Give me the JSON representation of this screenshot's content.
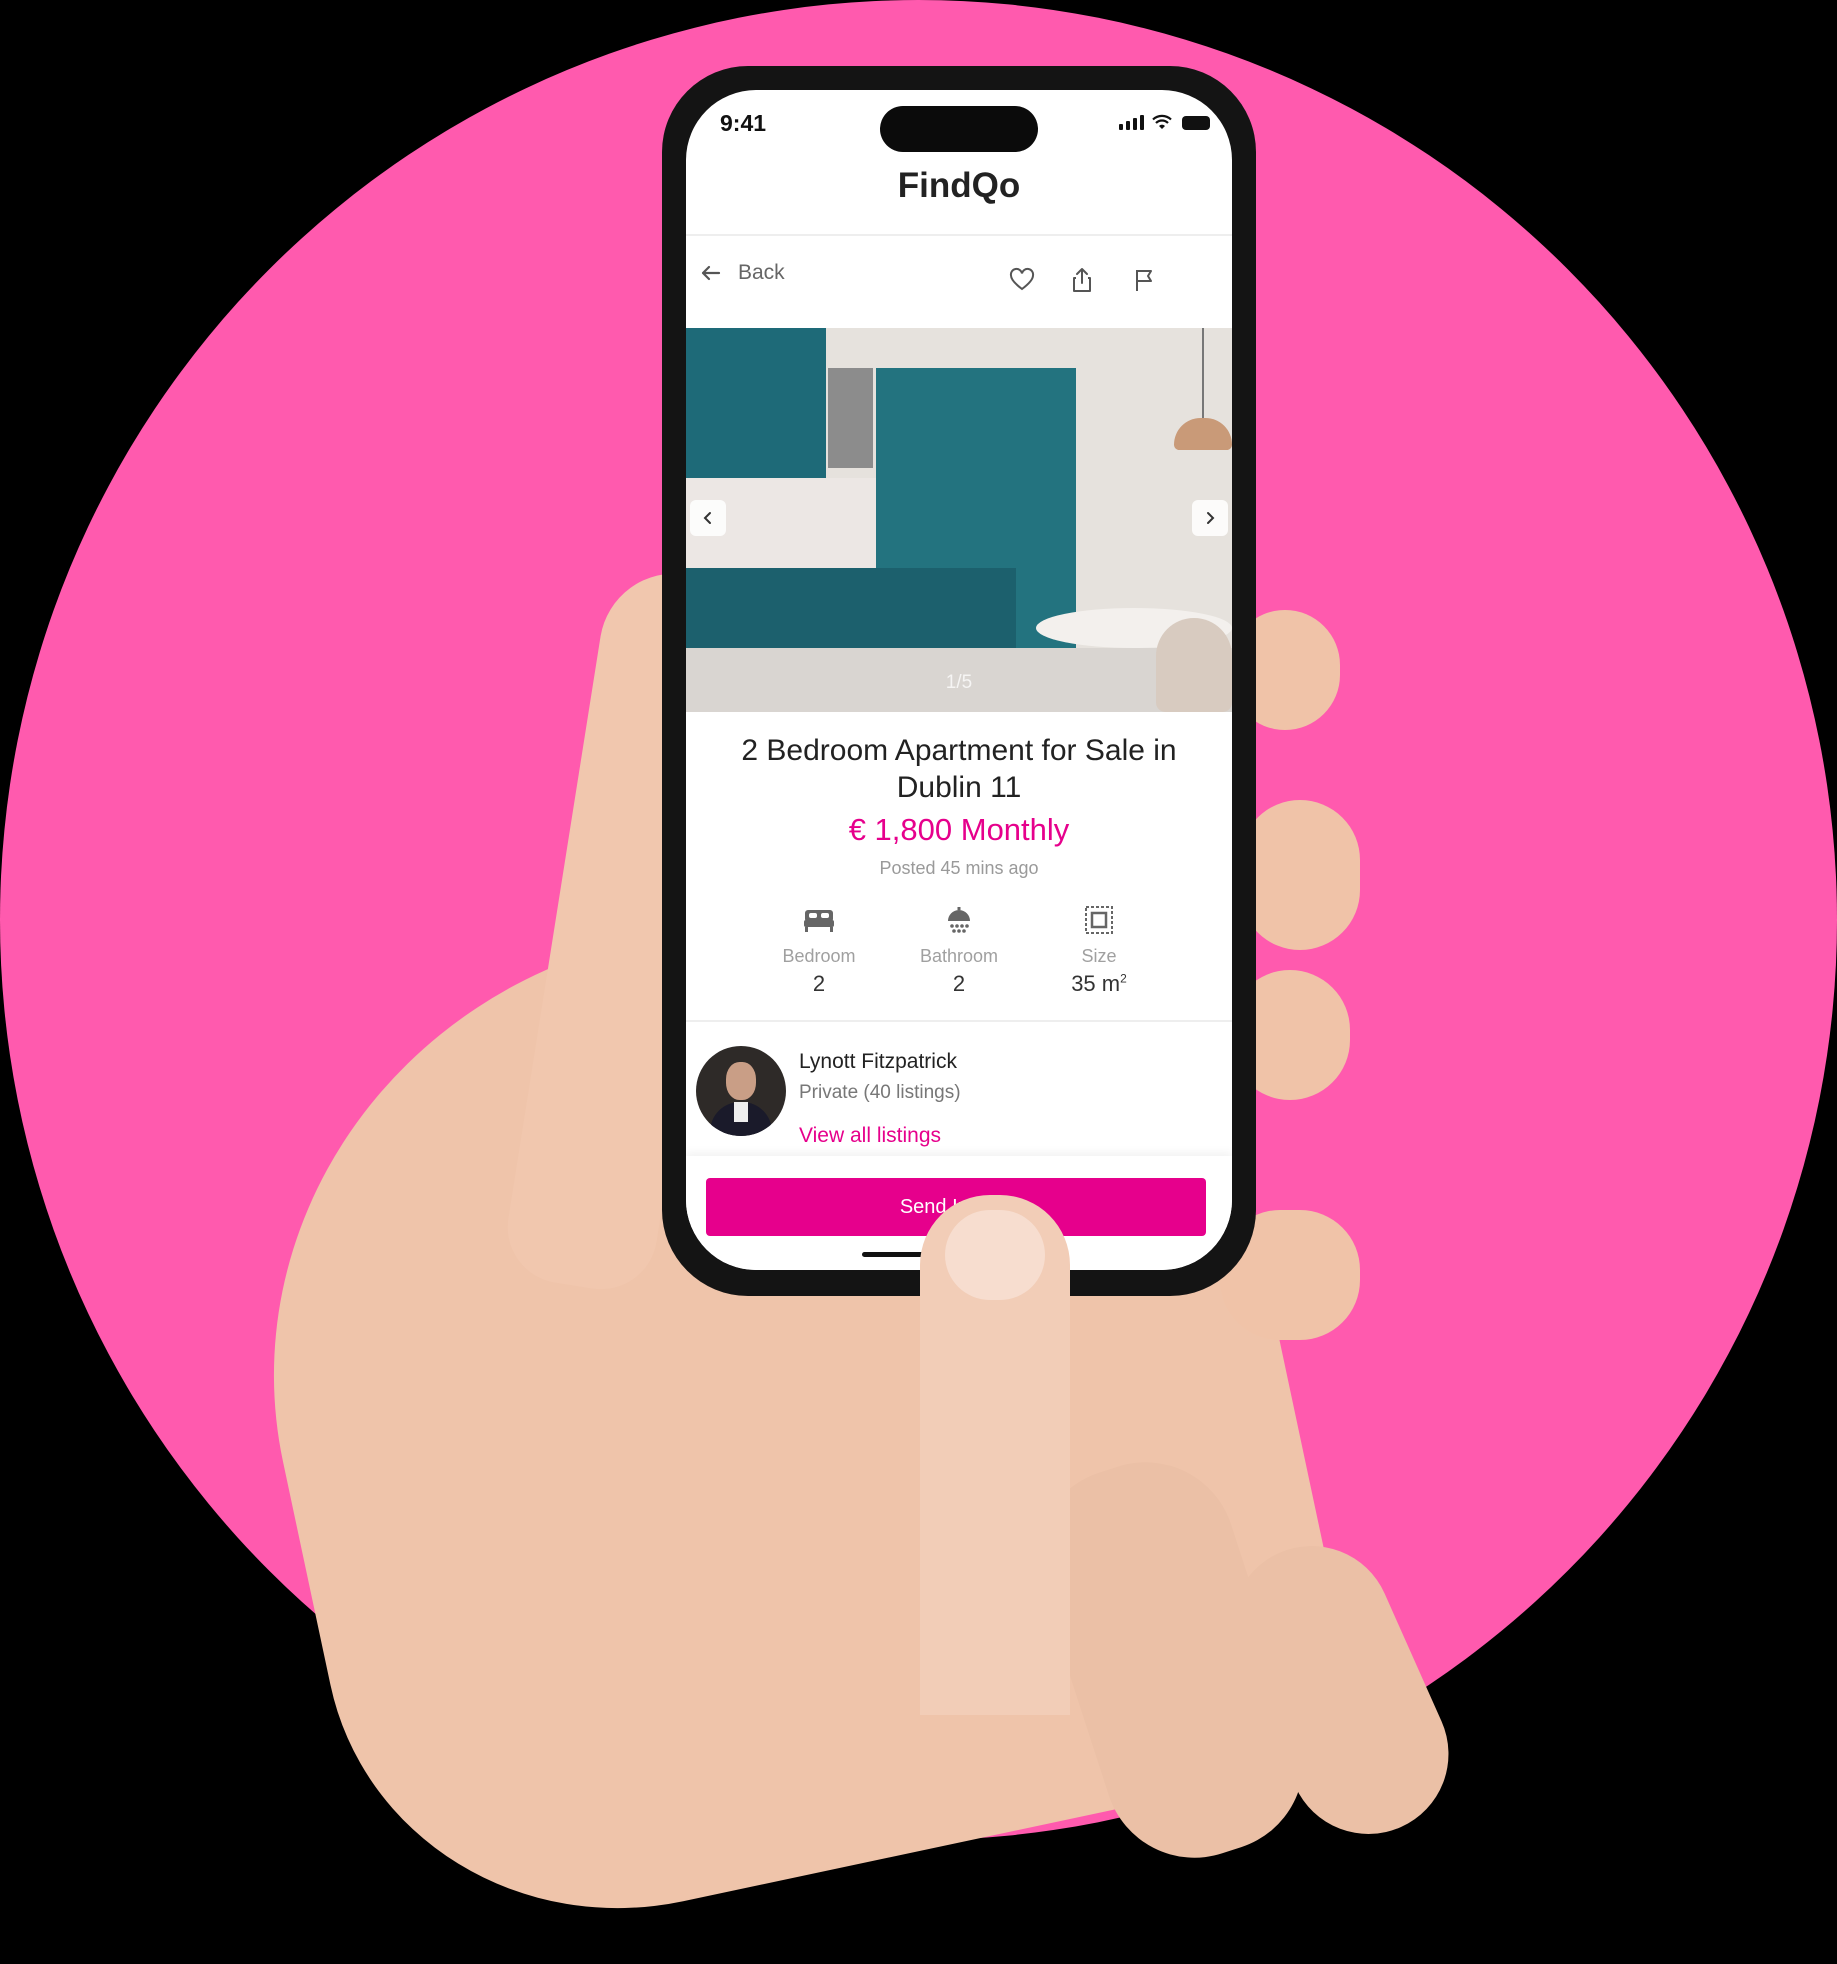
{
  "status_bar": {
    "time": "9:41"
  },
  "app": {
    "title": "FindQo"
  },
  "nav": {
    "back_label": "Back",
    "actions": [
      "favorite",
      "share",
      "report"
    ]
  },
  "gallery": {
    "counter": "1/5"
  },
  "listing": {
    "title": "2 Bedroom Apartment for Sale in Dublin 11",
    "price": "€ 1,800 Monthly",
    "posted": "Posted 45 mins ago",
    "features": [
      {
        "icon": "bed-icon",
        "label": "Bedroom",
        "value": "2"
      },
      {
        "icon": "shower-icon",
        "label": "Bathroom",
        "value": "2"
      },
      {
        "icon": "size-icon",
        "label": "Size",
        "value": "35 m",
        "sup": "2"
      }
    ]
  },
  "seller": {
    "name": "Lynott Fitzpatrick",
    "meta": "Private (40 listings)",
    "link": "View all listings"
  },
  "cta": {
    "label": "Send Inquiry"
  },
  "colors": {
    "accent": "#E6008C",
    "background_circle": "#FF5AAE"
  }
}
